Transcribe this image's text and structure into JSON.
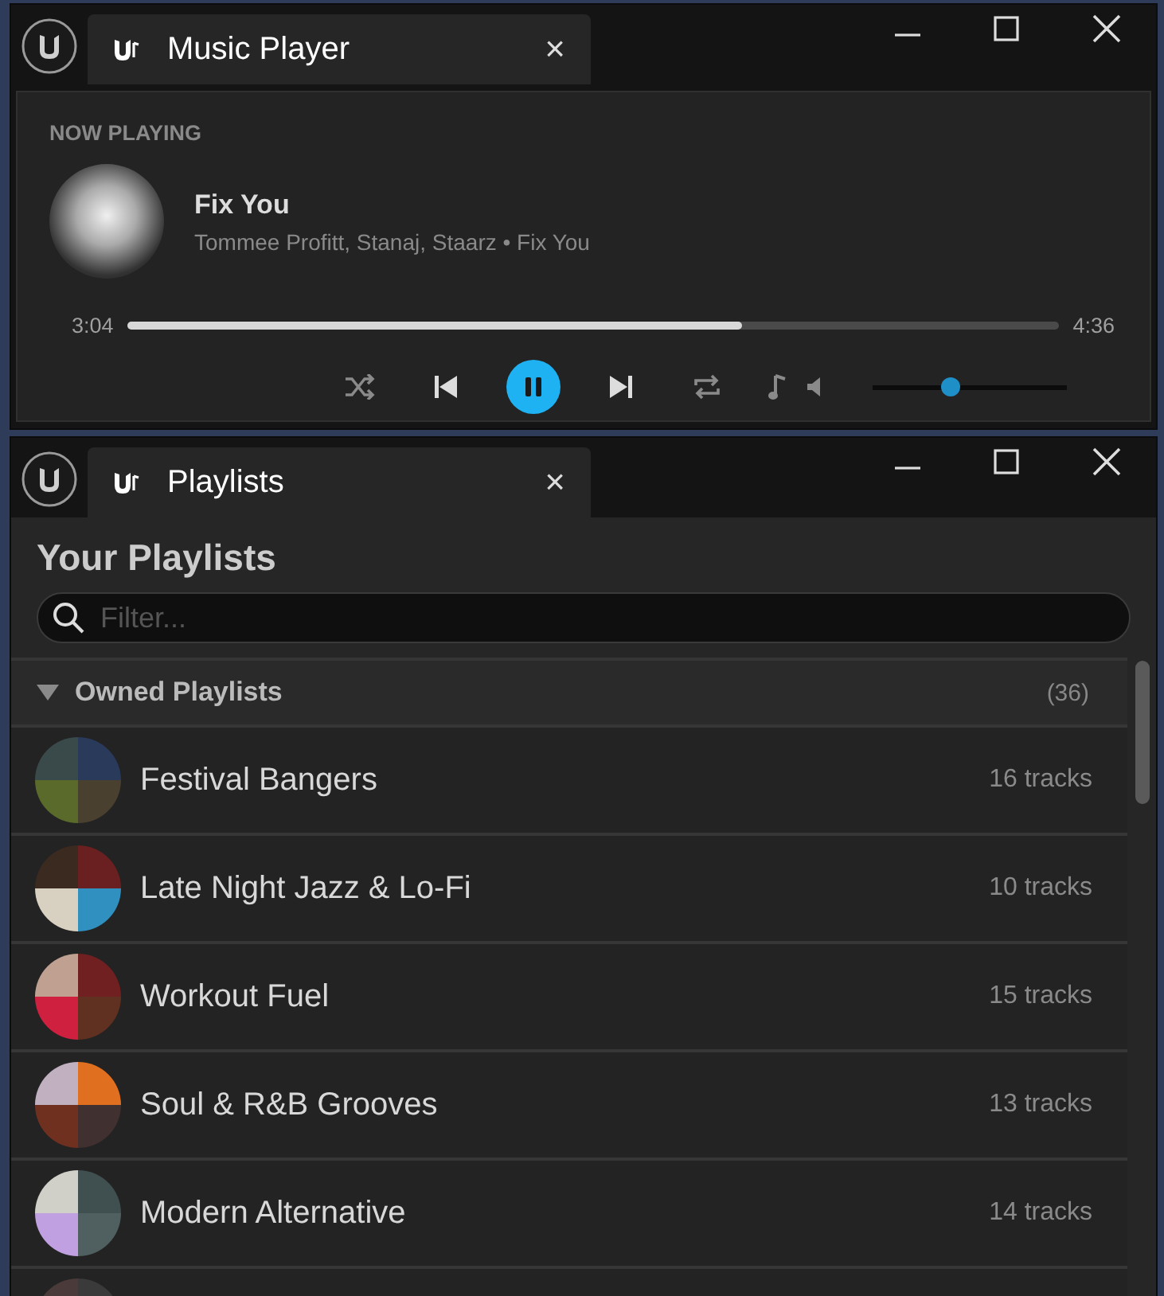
{
  "player_window": {
    "tab": {
      "title": "Music Player",
      "close": "×"
    },
    "now_playing": {
      "label": "NOW PLAYING",
      "track": "Fix You",
      "subtitle": "Tommee Profitt, Stanaj, Staarz • Fix You"
    },
    "progress": {
      "elapsed": "3:04",
      "total": "4:36",
      "level": 0.66
    },
    "controls": {
      "playing": true
    },
    "volume": {
      "level": 0.4
    }
  },
  "playlists_window": {
    "tab": {
      "title": "Playlists",
      "close": "×"
    },
    "heading": "Your Playlists",
    "search": {
      "placeholder": "Filter..."
    },
    "group": {
      "label": "Owned Playlists",
      "count": "(36)",
      "expanded": true
    },
    "playlists": [
      {
        "name": "Festival Bangers",
        "tracks": "16 tracks"
      },
      {
        "name": "Late Night Jazz & Lo-Fi",
        "tracks": "10 tracks"
      },
      {
        "name": "Workout Fuel",
        "tracks": "15 tracks"
      },
      {
        "name": "Soul & R&B Grooves",
        "tracks": "13 tracks"
      },
      {
        "name": "Modern Alternative",
        "tracks": "14 tracks"
      }
    ]
  }
}
